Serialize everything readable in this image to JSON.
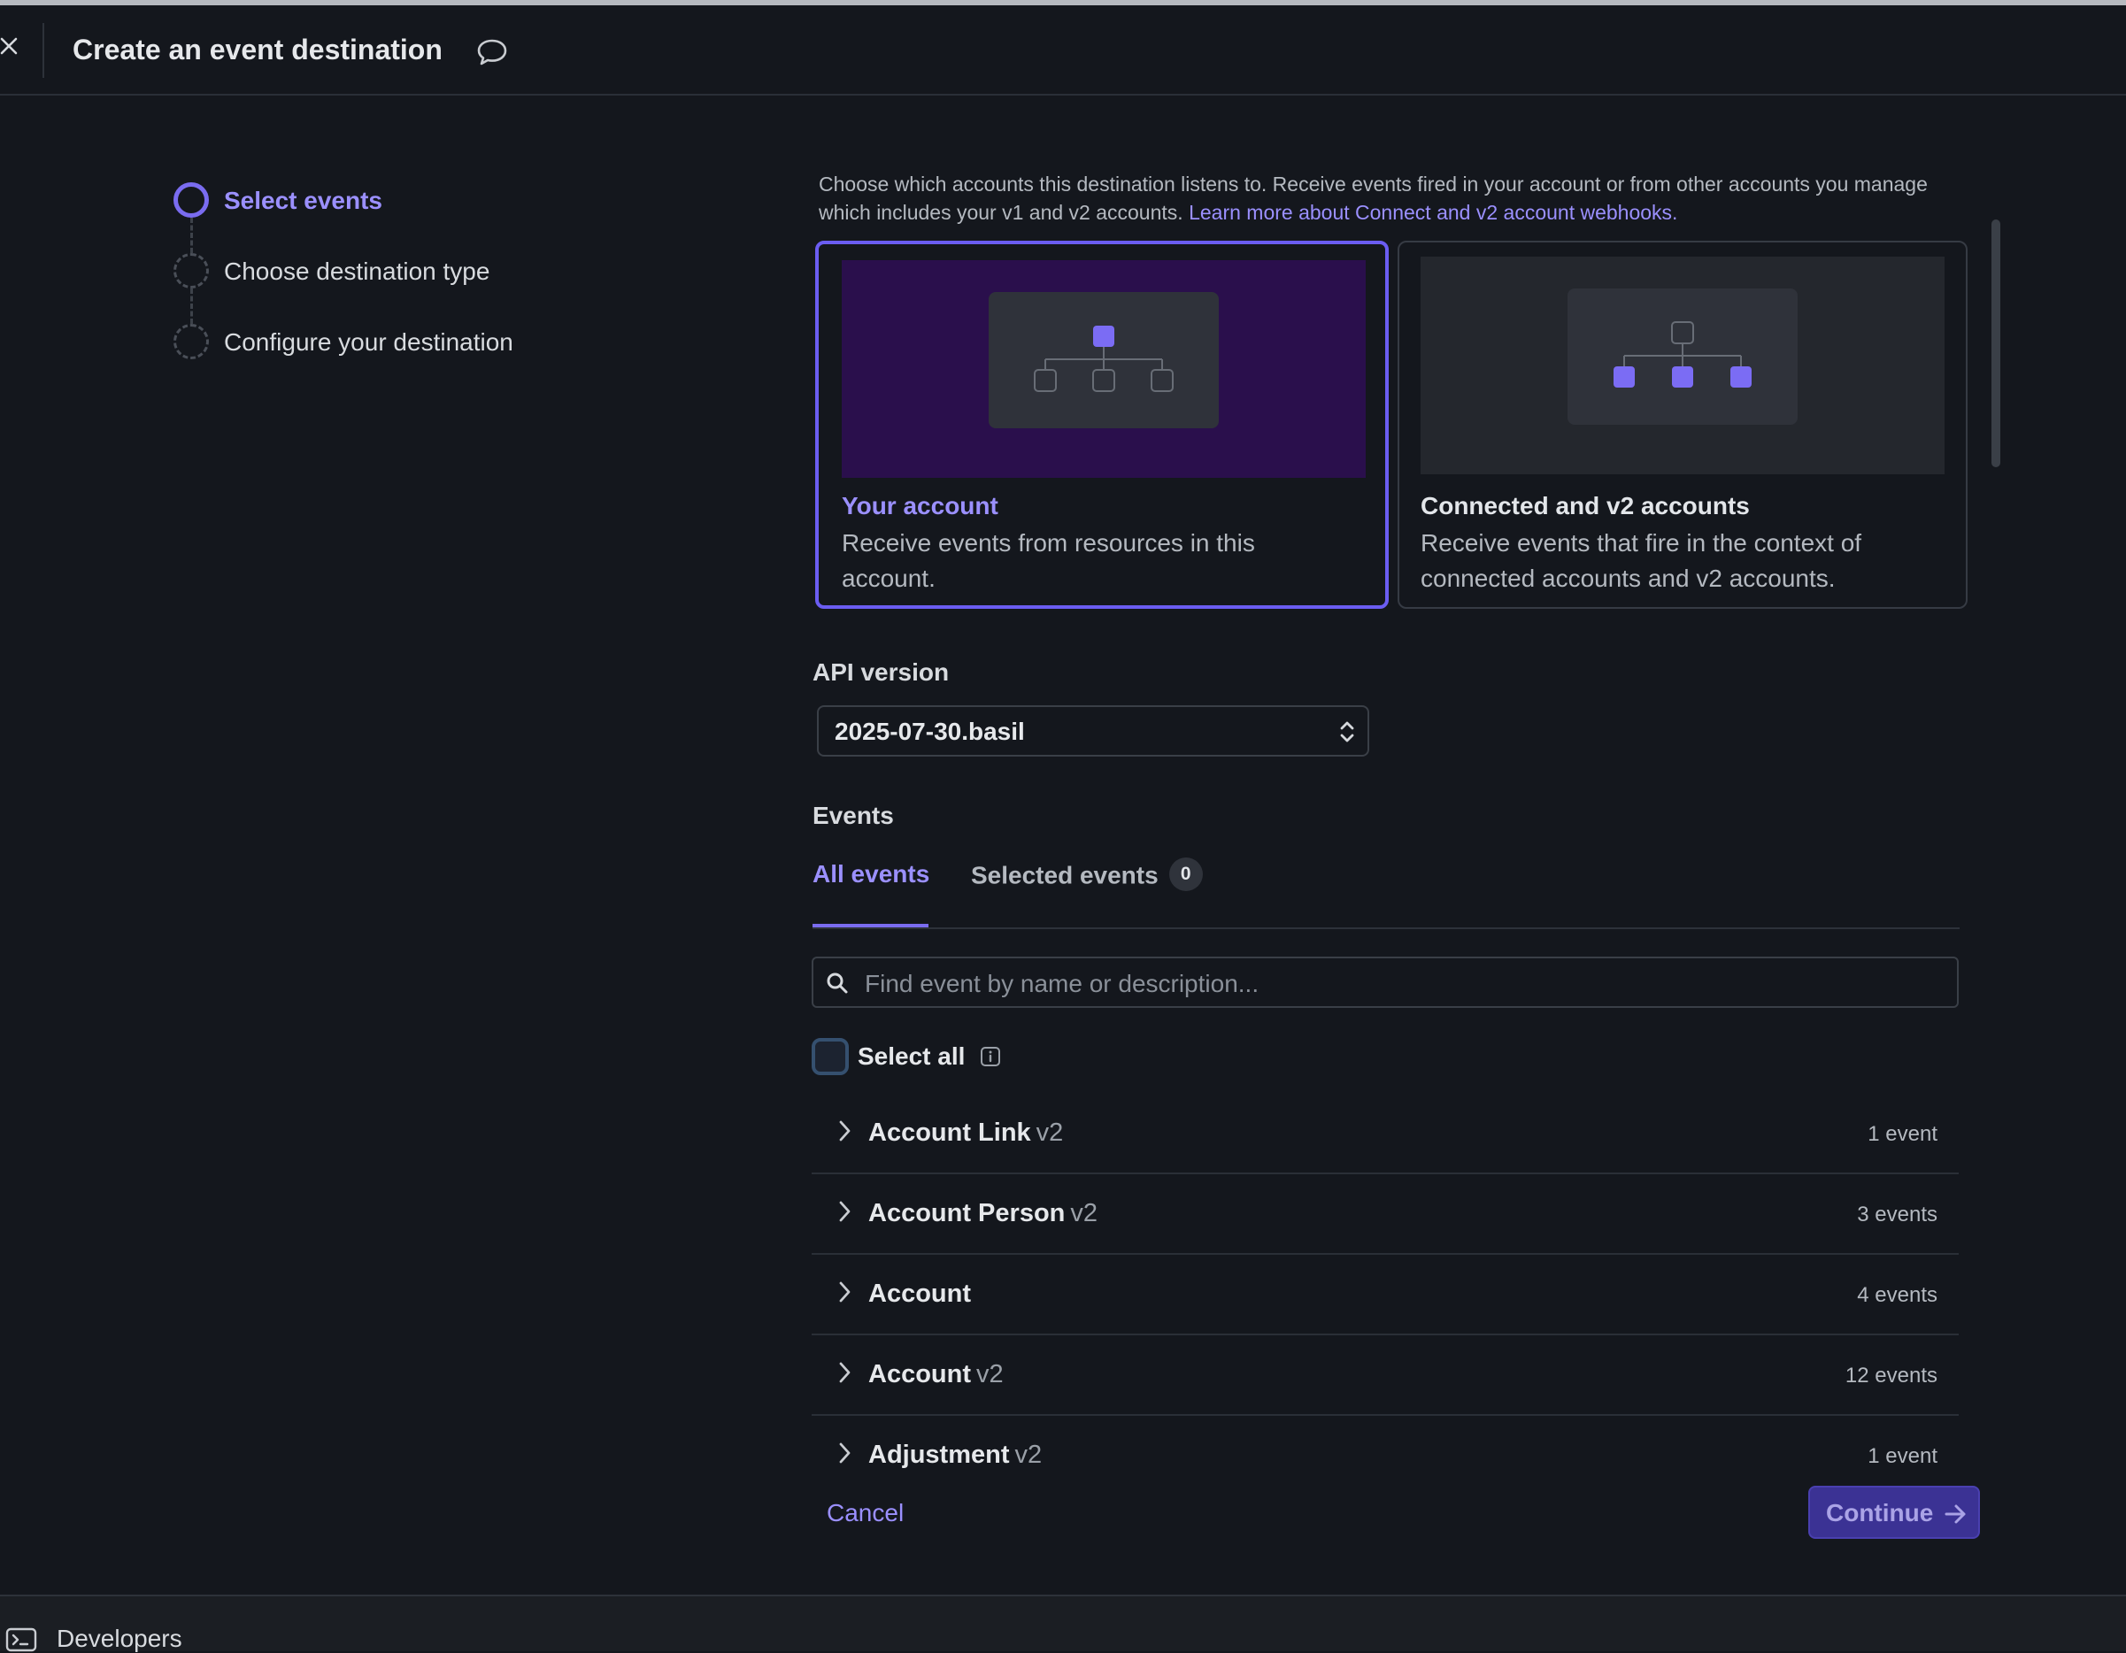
{
  "header": {
    "title": "Create an event destination"
  },
  "stepper": {
    "steps": [
      {
        "label": "Select events",
        "state": "active"
      },
      {
        "label": "Choose destination type",
        "state": "pending"
      },
      {
        "label": "Configure your destination",
        "state": "pending"
      }
    ]
  },
  "intro": {
    "text": "Choose which accounts this destination listens to. Receive events fired in your account or from other accounts you manage which includes your v1 and v2 accounts. ",
    "link": "Learn more about Connect and v2 account webhooks."
  },
  "cards": [
    {
      "title": "Your account",
      "description": "Receive events from resources in this account.",
      "selected": true
    },
    {
      "title": "Connected and v2 accounts",
      "description": "Receive events that fire in the context of connected accounts and v2 accounts.",
      "selected": false
    }
  ],
  "api_version": {
    "label": "API version",
    "value": "2025-07-30.basil"
  },
  "events": {
    "label": "Events",
    "tabs": [
      {
        "label": "All events",
        "active": true
      },
      {
        "label": "Selected events",
        "badge": "0",
        "active": false
      }
    ],
    "search_placeholder": "Find event by name or description...",
    "select_all_label": "Select all",
    "groups": [
      {
        "name": "Account Link",
        "version": "v2",
        "count": "1 event"
      },
      {
        "name": "Account Person",
        "version": "v2",
        "count": "3 events"
      },
      {
        "name": "Account",
        "version": "",
        "count": "4 events"
      },
      {
        "name": "Account",
        "version": "v2",
        "count": "12 events"
      },
      {
        "name": "Adjustment",
        "version": "v2",
        "count": "1 event"
      }
    ]
  },
  "actions": {
    "cancel": "Cancel",
    "continue": "Continue"
  },
  "footer": {
    "label": "Developers"
  },
  "colors": {
    "accent": "#7a6cf0",
    "accent_text": "#9b90ff",
    "background": "#14171d"
  }
}
